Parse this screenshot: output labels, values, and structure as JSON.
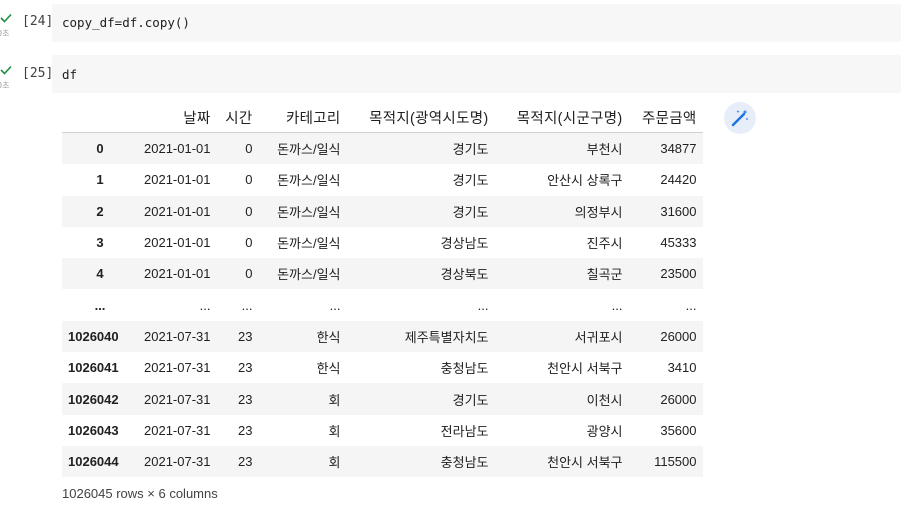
{
  "cells": [
    {
      "prompt": "[24]",
      "code": "copy_df=df.copy()",
      "elapsed": "0초"
    },
    {
      "prompt": "[25]",
      "code": "df",
      "elapsed": "0초"
    }
  ],
  "table": {
    "columns": [
      "",
      "날짜",
      "시간",
      "카테고리",
      "목적지(광역시도명)",
      "목적지(시군구명)",
      "주문금액"
    ],
    "rows": [
      [
        "0",
        "2021-01-01",
        "0",
        "돈까스/일식",
        "경기도",
        "부천시",
        "34877"
      ],
      [
        "1",
        "2021-01-01",
        "0",
        "돈까스/일식",
        "경기도",
        "안산시 상록구",
        "24420"
      ],
      [
        "2",
        "2021-01-01",
        "0",
        "돈까스/일식",
        "경기도",
        "의정부시",
        "31600"
      ],
      [
        "3",
        "2021-01-01",
        "0",
        "돈까스/일식",
        "경상남도",
        "진주시",
        "45333"
      ],
      [
        "4",
        "2021-01-01",
        "0",
        "돈까스/일식",
        "경상북도",
        "칠곡군",
        "23500"
      ],
      [
        "...",
        "...",
        "...",
        "...",
        "...",
        "...",
        "..."
      ],
      [
        "1026040",
        "2021-07-31",
        "23",
        "한식",
        "제주특별자치도",
        "서귀포시",
        "26000"
      ],
      [
        "1026041",
        "2021-07-31",
        "23",
        "한식",
        "충청남도",
        "천안시 서북구",
        "3410"
      ],
      [
        "1026042",
        "2021-07-31",
        "23",
        "회",
        "경기도",
        "이천시",
        "26000"
      ],
      [
        "1026043",
        "2021-07-31",
        "23",
        "회",
        "전라남도",
        "광양시",
        "35600"
      ],
      [
        "1026044",
        "2021-07-31",
        "23",
        "회",
        "충청남도",
        "천안시 서북구",
        "115500"
      ]
    ],
    "footer": "1026045 rows × 6 columns"
  },
  "icons": {
    "check": "check-icon",
    "wand": "magic-wand-icon"
  },
  "colors": {
    "check": "#1e8e3e",
    "wand": "#1a73e8",
    "code_bg": "#f7f7f7"
  }
}
